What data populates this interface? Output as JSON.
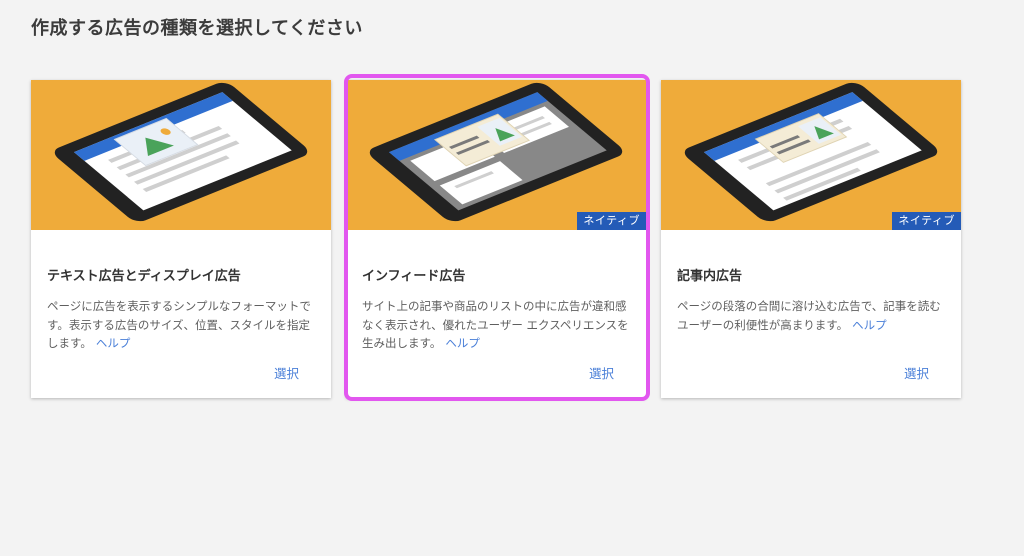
{
  "page_title": "作成する広告の種類を選択してください",
  "colors": {
    "hero_background": "#efab3a",
    "badge_background": "#245bb7",
    "selection_outline": "#e257ef",
    "link": "#4a7fd8"
  },
  "cards": [
    {
      "title": "テキスト広告とディスプレイ広告",
      "description": "ページに広告を表示するシンプルなフォーマットです。表示する広告のサイズ、位置、スタイルを指定します。",
      "help": "ヘルプ",
      "select": "選択",
      "badge": ""
    },
    {
      "title": "インフィード広告",
      "description": "サイト上の記事や商品のリストの中に広告が違和感なく表示され、優れたユーザー エクスペリエンスを生み出します。",
      "help": "ヘルプ",
      "select": "選択",
      "badge": "ネイティブ",
      "selected": true
    },
    {
      "title": "記事内広告",
      "description": "ページの段落の合間に溶け込む広告で、記事を読むユーザーの利便性が高まります。",
      "help": "ヘルプ",
      "select": "選択",
      "badge": "ネイティブ"
    }
  ]
}
